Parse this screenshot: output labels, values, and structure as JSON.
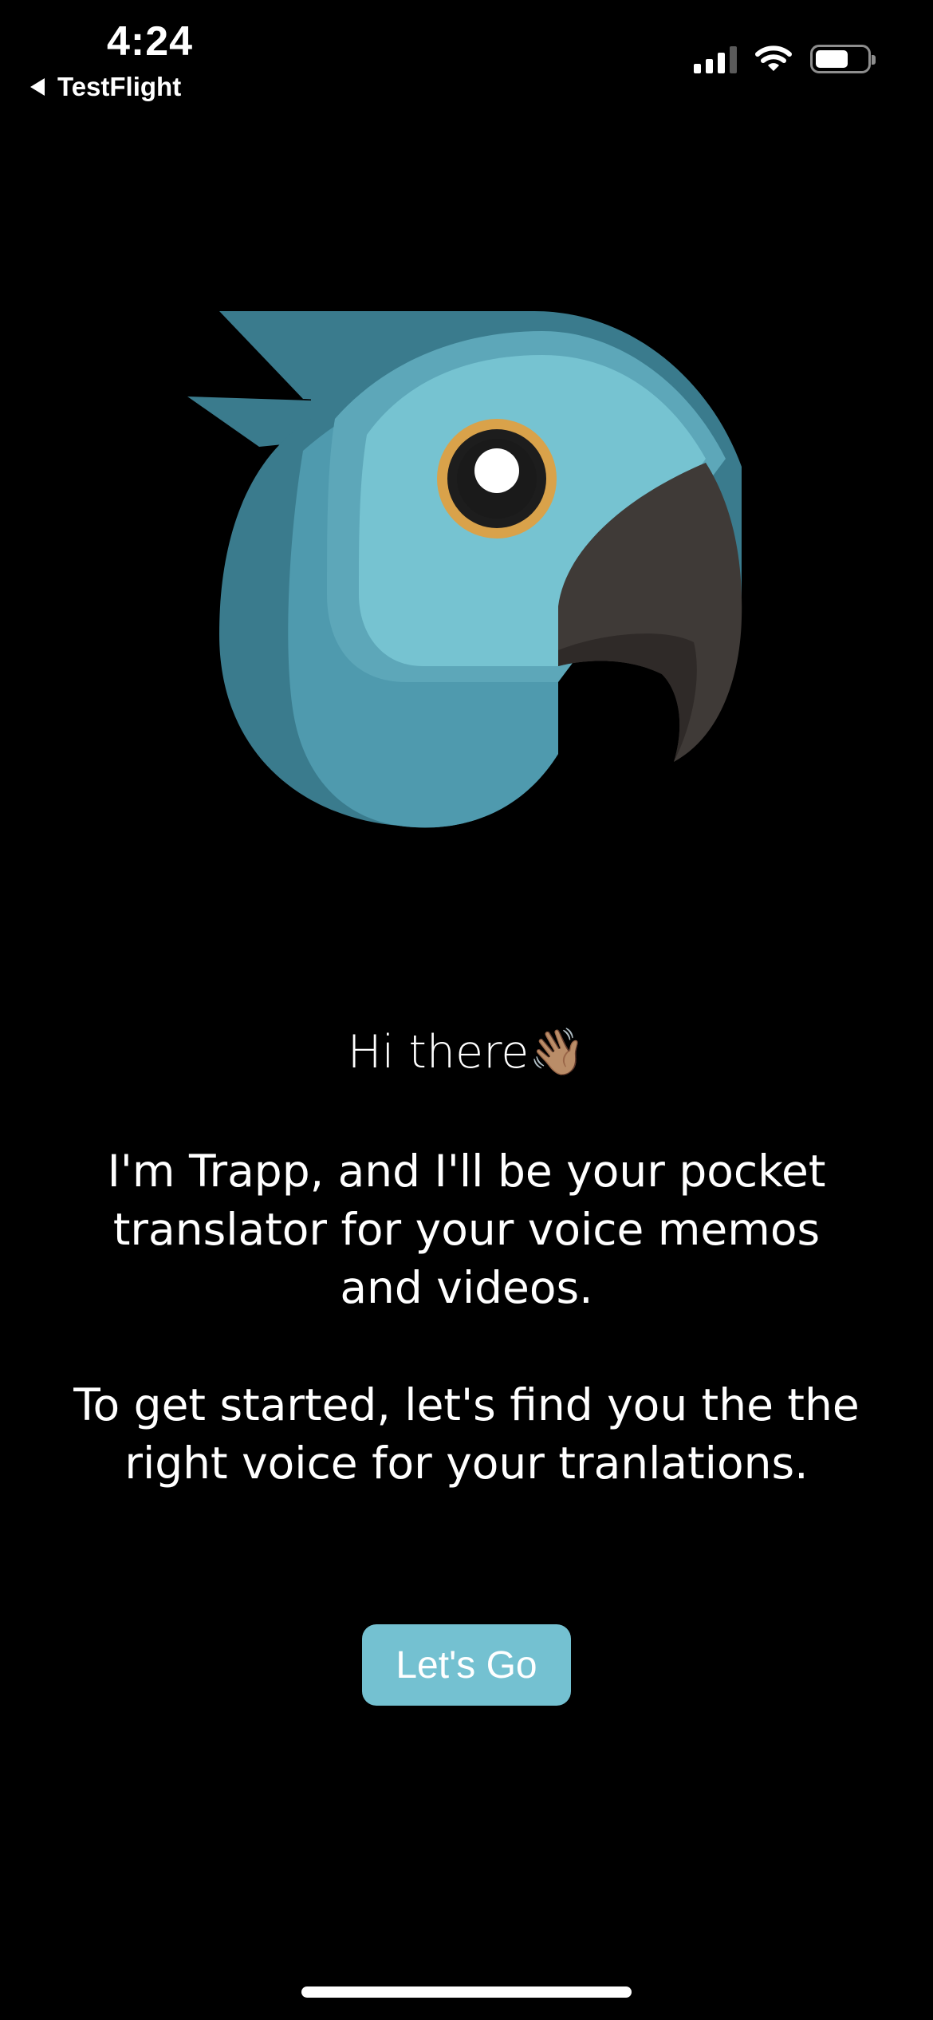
{
  "status_bar": {
    "time": "4:24",
    "back_app_label": "TestFlight",
    "icons": [
      "cellular-signal-icon",
      "wifi-icon",
      "battery-icon"
    ],
    "battery_level": 0.55
  },
  "logo": {
    "icon": "parrot-logo",
    "colors": {
      "light_blue": "#76c3d1",
      "mid_blue": "#4f9aae",
      "dark_blue": "#3a7b8d",
      "beak": "#3f3a37",
      "eye_ring": "#d9a24a"
    }
  },
  "onboarding": {
    "greeting": "Hi there👋🏽",
    "paragraph_1": "I'm Trapp, and I'll be your pocket translator for your voice memos and videos.",
    "paragraph_2": "To get started, let's find you the the right voice for your tranlations.",
    "cta_label": "Let's Go"
  },
  "colors": {
    "background": "#000000",
    "accent": "#74c1d1",
    "text": "#ffffff"
  }
}
